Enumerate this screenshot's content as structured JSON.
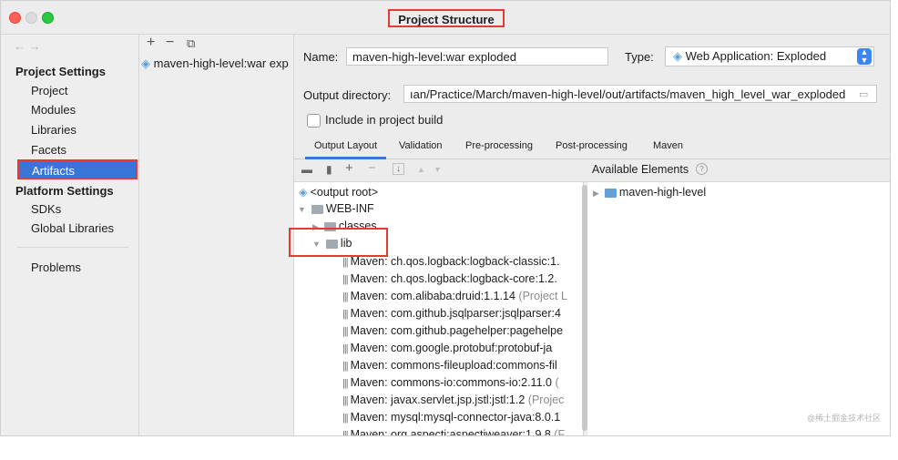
{
  "window": {
    "title": "Project Structure"
  },
  "sidebar": {
    "nav": "← →",
    "section1": "Project Settings",
    "items1": [
      "Project",
      "Modules",
      "Libraries",
      "Facets",
      "Artifacts"
    ],
    "section2": "Platform Settings",
    "items2": [
      "SDKs",
      "Global Libraries"
    ],
    "problems": "Problems"
  },
  "artifacts": {
    "toolbar": {
      "add": "+",
      "remove": "−",
      "copy": "⧉"
    },
    "items": [
      "maven-high-level:war exp"
    ]
  },
  "form": {
    "name_label": "Name:",
    "name_value": "maven-high-level:war exploded",
    "type_label": "Type:",
    "type_value": "Web Application: Exploded",
    "output_label": "Output directory:",
    "output_value": "ıan/Practice/March/maven-high-level/out/artifacts/maven_high_level_war_exploded",
    "include_label": "Include in project build"
  },
  "tabs": [
    "Output Layout",
    "Validation",
    "Pre-processing",
    "Post-processing",
    "Maven"
  ],
  "available_elements_label": "Available Elements",
  "tree": {
    "root": "<output root>",
    "webinf": "WEB-INF",
    "classes": "classes",
    "lib": "lib",
    "jars": [
      {
        "text": "Maven: ch.qos.logback:logback-classic:1.",
        "gray": ""
      },
      {
        "text": "Maven: ch.qos.logback:logback-core:1.2.",
        "gray": ""
      },
      {
        "text": "Maven: com.alibaba:druid:1.1.14",
        "gray": " (Project L"
      },
      {
        "text": "Maven: com.github.jsqlparser:jsqlparser:4",
        "gray": ""
      },
      {
        "text": "Maven: com.github.pagehelper:pagehelpe",
        "gray": ""
      },
      {
        "text": "Maven: com.google.protobuf:protobuf-ja",
        "gray": ""
      },
      {
        "text": "Maven: commons-fileupload:commons-fil",
        "gray": ""
      },
      {
        "text": "Maven: commons-io:commons-io:2.11.0",
        "gray": " ("
      },
      {
        "text": "Maven: javax.servlet.jsp.jstl:jstl:1.2",
        "gray": " (Projec"
      },
      {
        "text": "Maven: mysql:mysql-connector-java:8.0.1",
        "gray": ""
      },
      {
        "text": "Maven: org.aspectj:aspectjweaver:1.9.8",
        "gray": " (F"
      }
    ]
  },
  "available": {
    "items": [
      "maven-high-level"
    ]
  },
  "watermark": "@稀土掘金技术社区"
}
